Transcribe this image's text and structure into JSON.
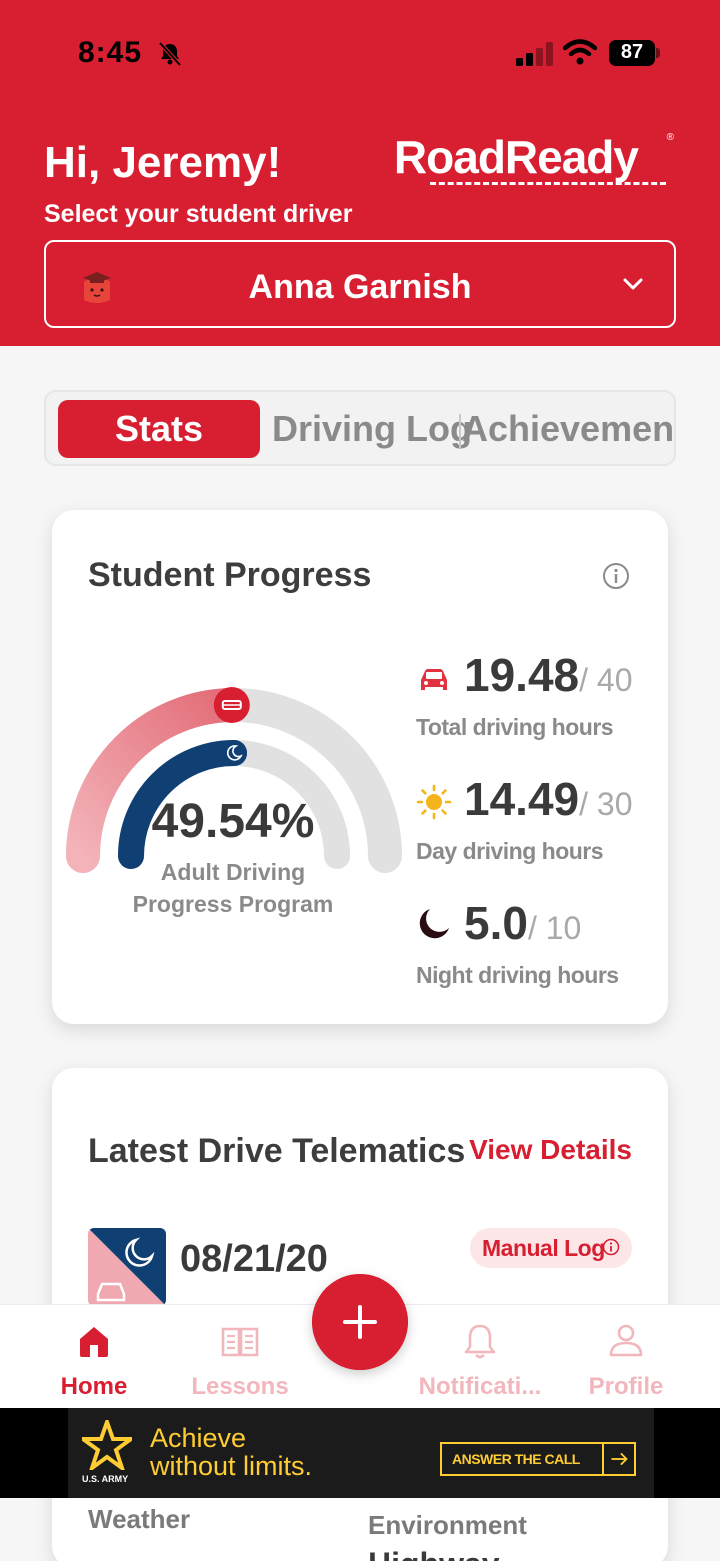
{
  "status_bar": {
    "time": "8:45",
    "battery": "87"
  },
  "header": {
    "greeting": "Hi, Jeremy!",
    "subtitle": "Select your student driver",
    "logo": "RoadReady",
    "selected_driver": "Anna Garnish"
  },
  "tabs": [
    {
      "label": "Stats",
      "active": true
    },
    {
      "label": "Driving Log",
      "active": false
    },
    {
      "label": "Achievemen",
      "active": false
    }
  ],
  "progress": {
    "title": "Student Progress",
    "percent_text": "49.54%",
    "program_label": "Adult Driving Progress Program",
    "total_progress_fraction": 0.4954,
    "night_progress_fraction": 0.5,
    "stats": [
      {
        "icon": "car-icon",
        "value": "19.48",
        "goal": "/ 40",
        "label": "Total driving hours"
      },
      {
        "icon": "sun-icon",
        "value": "14.49",
        "goal": "/ 30",
        "label": "Day driving hours"
      },
      {
        "icon": "moon-icon",
        "value": "5.0",
        "goal": "/ 10",
        "label": "Night driving hours"
      }
    ]
  },
  "telematics": {
    "title": "Latest Drive Telematics",
    "view_details": "View Details",
    "date": "08/21/20",
    "badge": "Manual Log",
    "weather_label": "Weather",
    "environment_label": "Environment",
    "environment_value": "Highway"
  },
  "nav": [
    {
      "label": "Home",
      "icon": "home-icon",
      "active": true
    },
    {
      "label": "Lessons",
      "icon": "book-icon",
      "active": false
    },
    {
      "label": "Notificati...",
      "icon": "bell-icon",
      "active": false
    },
    {
      "label": "Profile",
      "icon": "person-icon",
      "active": false
    }
  ],
  "ad": {
    "brand": "U.S. ARMY",
    "line1": "Achieve",
    "line2": "without limits.",
    "cta": "ANSWER THE CALL"
  },
  "colors": {
    "brand_red": "#d71f31",
    "night_blue": "#0f3f73",
    "sun_yellow": "#f5b41a"
  }
}
